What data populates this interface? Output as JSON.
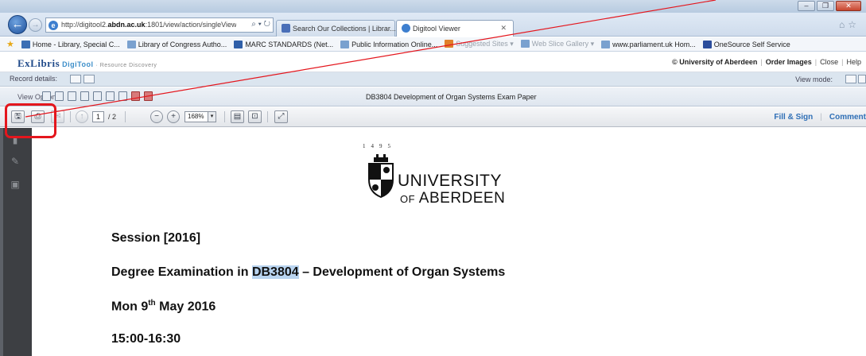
{
  "browser": {
    "window_title": "",
    "address_prefix": "http://digitool2.",
    "address_bold": "abdn.ac.uk",
    "address_suffix": ":1801/view/action/singleViewer.do?dvs=1",
    "address_controls": "⌕ ▾ ↻",
    "tabs": [
      {
        "label": "Search Our Collections | Librar...",
        "active": false
      },
      {
        "label": "Digitool Viewer",
        "active": true
      }
    ],
    "favorites": [
      {
        "label": "Home - Library, Special C...",
        "color": "#3c6fb4"
      },
      {
        "label": "Library of Congress Autho...",
        "color": "#7aa1cf"
      },
      {
        "label": "MARC STANDARDS (Net...",
        "color": "#2f5fa8"
      },
      {
        "label": "Public Information Online...",
        "color": "#7aa1cf"
      },
      {
        "label": "Suggested Sites ▾",
        "color": "#e0802a",
        "dim": true
      },
      {
        "label": "Web Slice Gallery ▾",
        "color": "#7aa1cf",
        "dim": true
      },
      {
        "label": "www.parliament.uk Hom...",
        "color": "#7aa1cf"
      },
      {
        "label": "OneSource Self Service",
        "color": "#2b4d9c"
      }
    ]
  },
  "digitool": {
    "logo_main": "ExLibris",
    "logo_digi": "DigiTool",
    "logo_sub": "· Resource Discovery",
    "copyright": "© University of Aberdeen",
    "order_images": "Order Images",
    "close": "Close",
    "help": "Help",
    "record_details": "Record details:",
    "view_mode": "View mode:",
    "view_options": "View Options:",
    "document_title": "DB3804 Development of Organ Systems Exam Paper"
  },
  "pdf_toolbar": {
    "current_page": "1",
    "total_pages": "/ 2",
    "zoom": "168%",
    "fill_sign": "Fill & Sign",
    "comment": "Comment"
  },
  "document": {
    "crest_year": "1495",
    "university_line1": "UNIVERSITY",
    "university_of": "OF",
    "university_line2": "ABERDEEN",
    "session": "Session [2016]",
    "degree_prefix": "Degree Examination in ",
    "course_code": "DB3804",
    "degree_suffix": " – Development of Organ Systems",
    "date_prefix": "Mon 9",
    "date_sup": "th",
    "date_suffix": " May 2016",
    "time": "15:00-16:30"
  },
  "colors": {
    "annotation_red": "#e4161d",
    "sidebar": "#3d3f43",
    "selection_highlight": "#b9d4f0",
    "link_blue": "#2f6fb6"
  }
}
